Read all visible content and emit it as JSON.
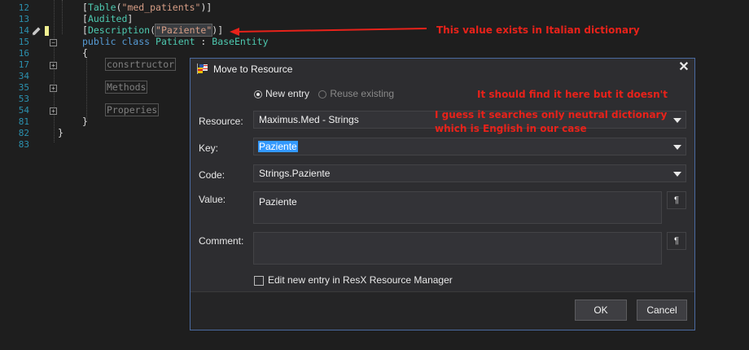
{
  "editor": {
    "line_numbers": [
      "12",
      "13",
      "14",
      "15",
      "16",
      "17",
      "34",
      "35",
      "53",
      "54",
      "81",
      "82",
      "83"
    ],
    "code": {
      "l12_open": "[",
      "l12_type": "Table",
      "l12_p1": "(",
      "l12_str": "\"med_patients\"",
      "l12_close": ")]",
      "l13_open": "[",
      "l13_type": "Audited",
      "l13_close": "]",
      "l14_open": "[",
      "l14_type": "Description",
      "l14_p1": "(",
      "l14_str": "\"Paziente\"",
      "l14_close": ")]",
      "l15_kw": "public class",
      "l15_type": "Patient",
      "l15_colon": " : ",
      "l15_base": "BaseEntity",
      "l16": "{",
      "l17": "consrtructor",
      "l35": "Methods",
      "l54": "Properies",
      "l81": "}",
      "l82": "}"
    }
  },
  "annotations": {
    "a1": "This value exists in Italian dictionary",
    "a2": "It should find it here but it doesn't",
    "a3": "I guess it searches only neutral dictionary",
    "a4": "which is English in our case"
  },
  "dialog": {
    "title": "Move to Resource",
    "radio_new": "New entry",
    "radio_reuse": "Reuse existing",
    "resource_label": "Resource:",
    "resource_value": "Maximus.Med - Strings",
    "key_label": "Key:",
    "key_value": "Paziente",
    "code_label": "Code:",
    "code_value": "Strings.Paziente",
    "value_label": "Value:",
    "value_value": "Paziente",
    "comment_label": "Comment:",
    "comment_value": "",
    "pilcrow": "¶",
    "checkbox_label": "Edit new entry in ResX Resource Manager",
    "ok": "OK",
    "cancel": "Cancel"
  },
  "colors": {
    "annotation": "#e8221a",
    "dialog_border": "#4b6aa0",
    "selection": "#3399ff"
  }
}
